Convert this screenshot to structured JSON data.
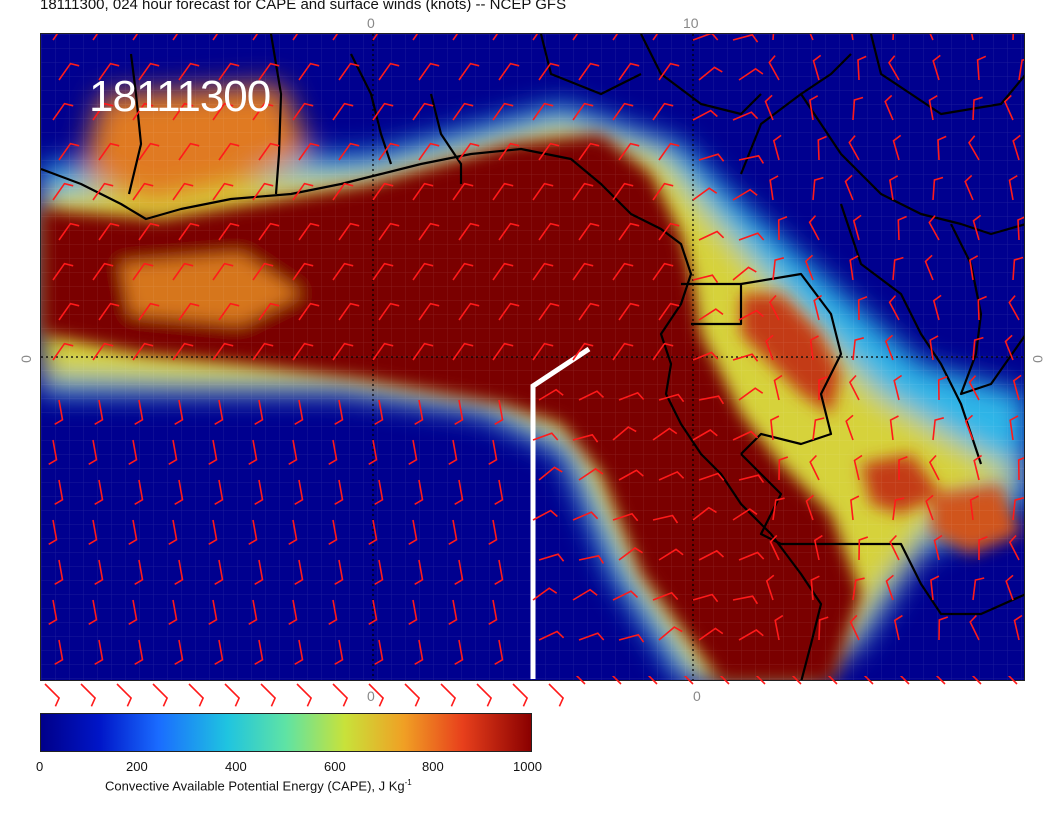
{
  "header": {
    "title": "18111300, 024 hour forecast for CAPE and surface winds (knots) -- NCEP GFS"
  },
  "map": {
    "stamp": "18111300",
    "ticks": {
      "top_left": "0",
      "top_right": "10",
      "bottom_left": "0",
      "bottom_right": "0",
      "left": "0",
      "right": "0"
    },
    "colors": {
      "low": "#00008a",
      "high": "#8a0000",
      "barb": "#ff1a1a",
      "coast": "#000000",
      "transect": "#ffffff"
    }
  },
  "colorbar": {
    "ticks": [
      "0",
      "200",
      "400",
      "600",
      "800",
      "1000"
    ],
    "title": "Convective Available Potential Energy (CAPE), J Kg",
    "title_superscript": "-1"
  }
}
